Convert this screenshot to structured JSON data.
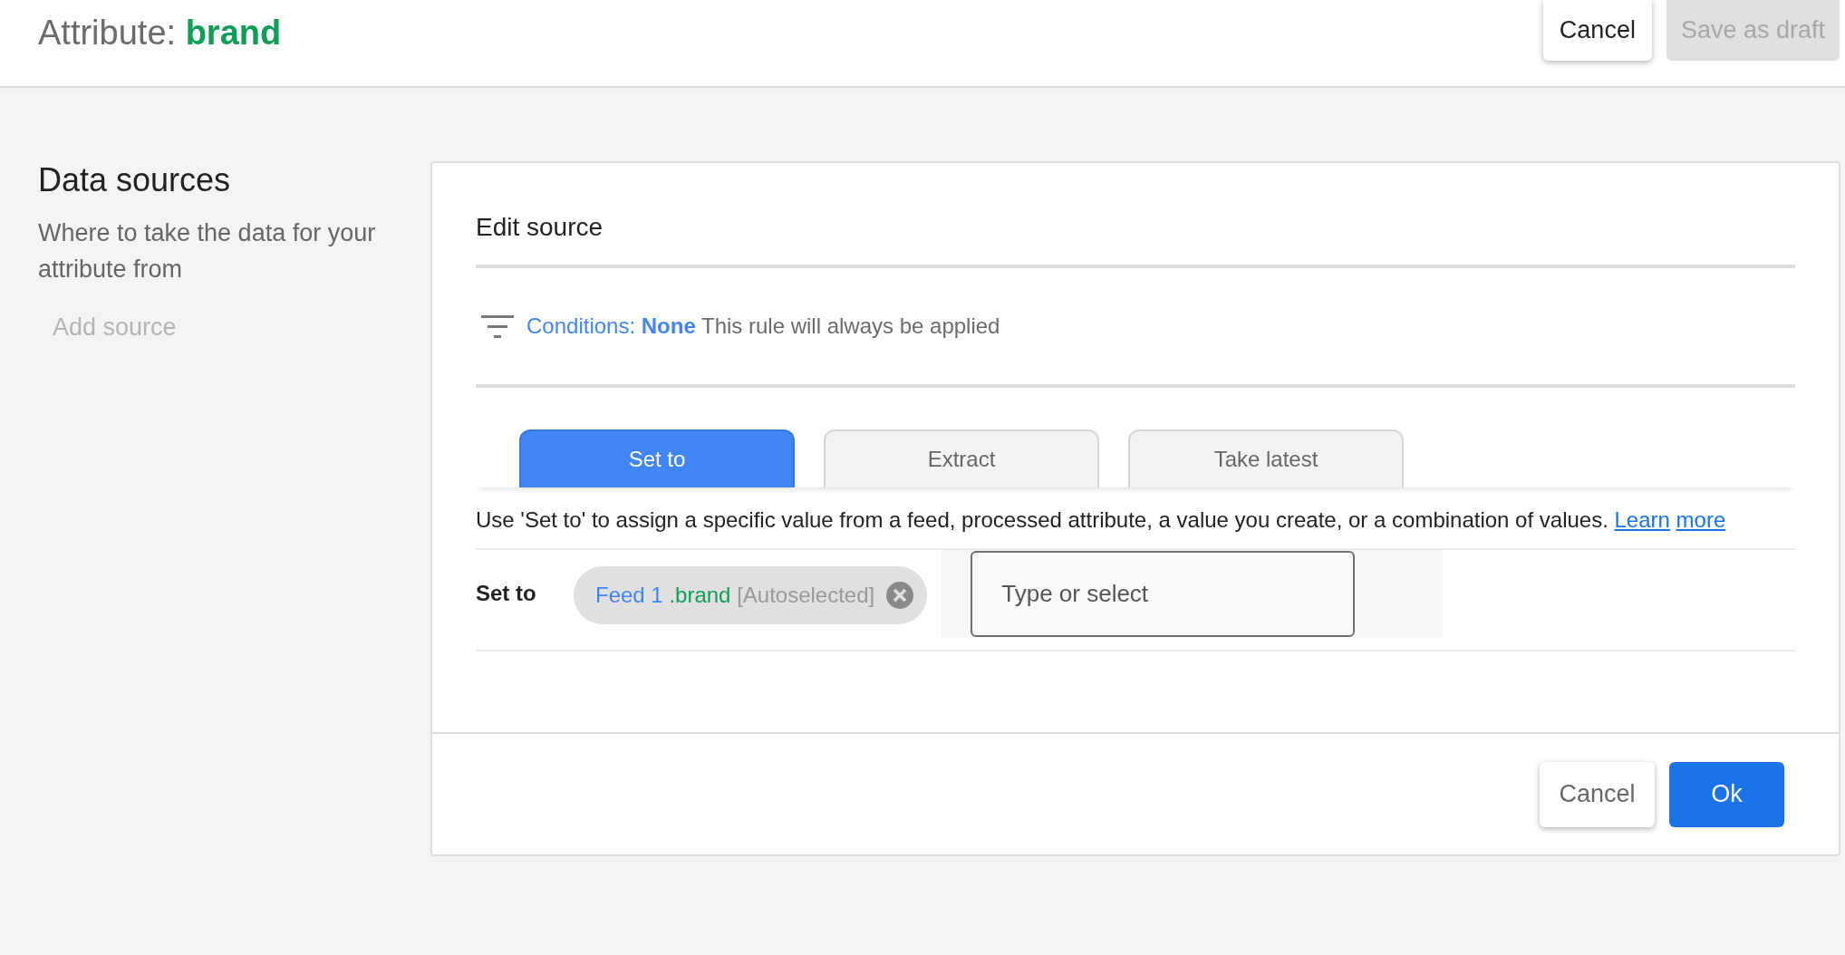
{
  "header": {
    "title_label": "Attribute:",
    "title_value": "brand",
    "buttons": [
      {
        "label": "Cancel",
        "disabled": false
      },
      {
        "label": "Save as draft",
        "disabled": true
      }
    ]
  },
  "section": {
    "title": "Data sources",
    "description": "Where to take the data for your attribute from",
    "add_source": {
      "label": "Add source",
      "disabled": true
    }
  },
  "editor": {
    "title": "Edit source",
    "conditions": {
      "label": "Conditions:",
      "value": "None",
      "note": "This rule will always be applied"
    },
    "tabs": [
      {
        "label": "Set to",
        "selected": true
      },
      {
        "label": "Extract",
        "selected": false
      },
      {
        "label": "Take latest",
        "selected": false
      }
    ],
    "help": {
      "text": "Use 'Set to' to assign a specific value from a feed, processed attribute, a value you create, or a combination of values.",
      "link": "Learn more"
    },
    "set_to": {
      "label": "Set to",
      "chip": {
        "source": "Feed 1",
        "field": ".brand",
        "note": "[Autoselected]"
      },
      "input": {
        "placeholder": "Type or select"
      }
    },
    "footer_buttons": [
      {
        "label": "Cancel",
        "kind": "secondary"
      },
      {
        "label": "Ok",
        "kind": "primary"
      }
    ]
  }
}
